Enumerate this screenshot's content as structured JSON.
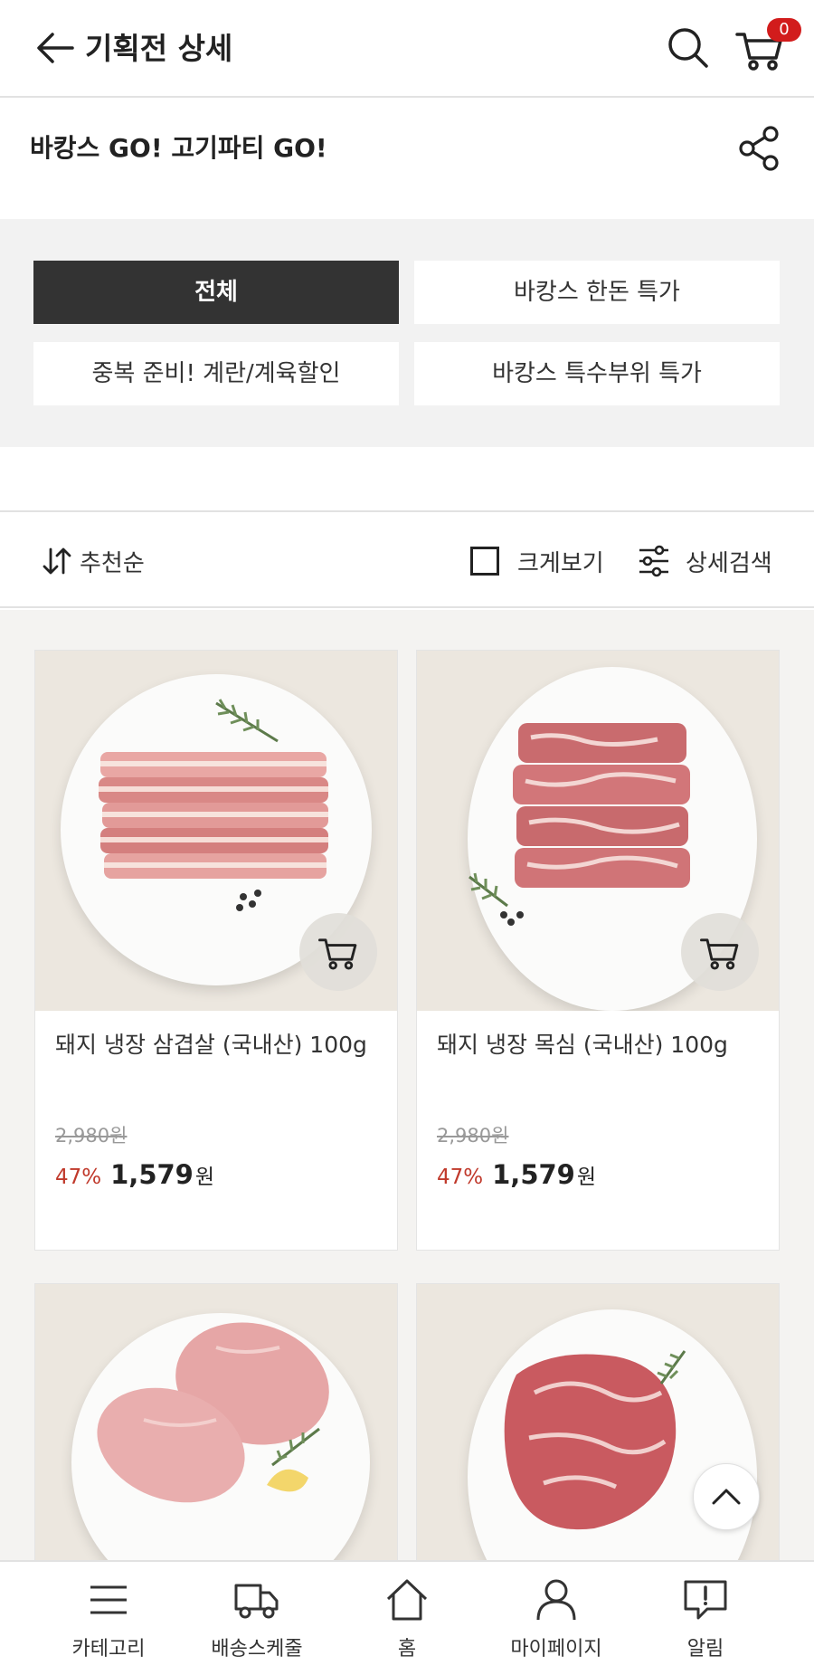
{
  "header": {
    "title": "기획전 상세",
    "cart_count": "0"
  },
  "event": {
    "title": "바캉스 GO! 고기파티 GO!"
  },
  "tabs": [
    {
      "label": "전체",
      "active": true
    },
    {
      "label": "바캉스 한돈 특가",
      "active": false
    },
    {
      "label": "중복 준비! 계란/계육할인",
      "active": false
    },
    {
      "label": "바캉스 특수부위 특가",
      "active": false
    }
  ],
  "sortbar": {
    "sort_label": "추천순",
    "bigview_label": "크게보기",
    "filter_label": "상세검색"
  },
  "products": [
    {
      "name": "돼지 냉장 삼겹살 (국내산) 100g",
      "original_price": "2,980원",
      "discount": "47%",
      "price": "1,579",
      "currency": "원",
      "image": "pork-belly"
    },
    {
      "name": "돼지 냉장 목심 (국내산) 100g",
      "original_price": "2,980원",
      "discount": "47%",
      "price": "1,579",
      "currency": "원",
      "image": "pork-neck"
    },
    {
      "image": "pork-loin"
    },
    {
      "image": "pork-shoulder"
    }
  ],
  "bottom_nav": [
    {
      "label": "카테고리",
      "icon": "menu-icon"
    },
    {
      "label": "배송스케줄",
      "icon": "truck-icon"
    },
    {
      "label": "홈",
      "icon": "home-icon"
    },
    {
      "label": "마이페이지",
      "icon": "user-icon"
    },
    {
      "label": "알림",
      "icon": "notification-icon"
    }
  ],
  "colors": {
    "accent": "#d21c1c",
    "discount": "#c0392b",
    "active_tab": "#333333",
    "tab_bg": "#f2f2f2",
    "grid_bg": "#f4f3f1"
  }
}
